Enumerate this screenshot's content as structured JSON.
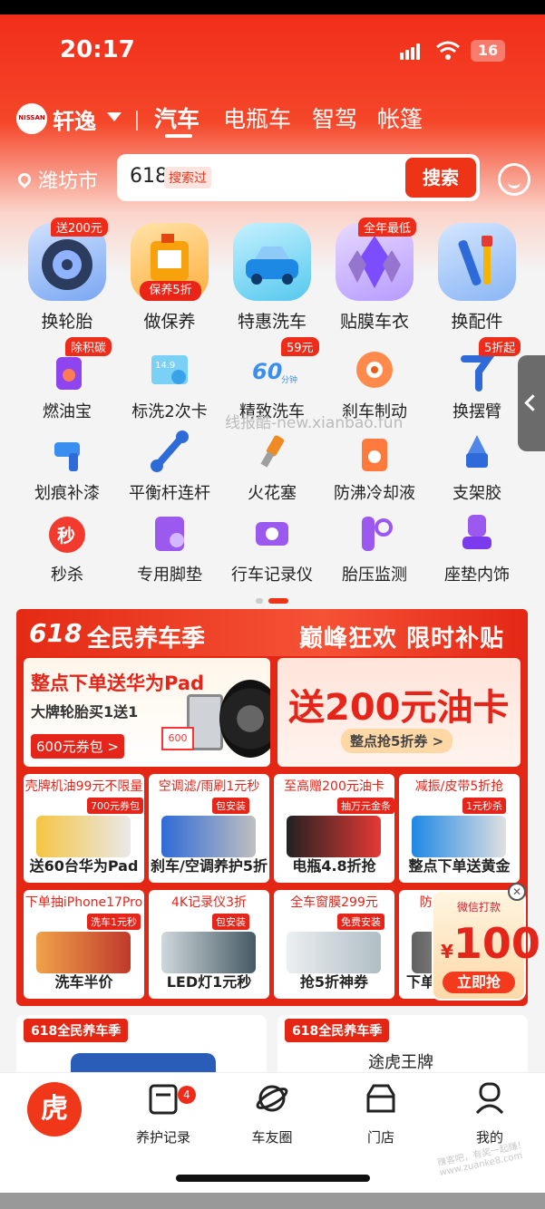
{
  "status": {
    "time": "20:17",
    "battery": "16"
  },
  "header": {
    "brand_name": "轩逸",
    "tabs": [
      "汽车",
      "电瓶车",
      "智驾",
      "帐篷"
    ],
    "location": "潍坊市",
    "search": {
      "query": "618",
      "tag": "搜索过",
      "button": "搜索"
    }
  },
  "services_big": [
    {
      "label": "换轮胎",
      "badge": "送200元"
    },
    {
      "label": "做保养",
      "tag": "保养5折"
    },
    {
      "label": "特惠洗车"
    },
    {
      "label": "贴膜车衣",
      "badge": "全年最低"
    },
    {
      "label": "换配件"
    }
  ],
  "services_small": [
    {
      "label": "燃油宝",
      "badge": "除积碳"
    },
    {
      "label": "标洗2次卡",
      "icon_text": "14.9"
    },
    {
      "label": "精致洗车",
      "badge": "59元",
      "icon_text": "60分钟"
    },
    {
      "label": "刹车制动"
    },
    {
      "label": "换摆臂",
      "badge": "5折起"
    },
    {
      "label": "划痕补漆"
    },
    {
      "label": "平衡杆连杆"
    },
    {
      "label": "火花塞"
    },
    {
      "label": "防沸冷却液"
    },
    {
      "label": "支架胶"
    },
    {
      "label": "秒杀",
      "icon_text": "秒"
    },
    {
      "label": "专用脚垫"
    },
    {
      "label": "行车记录仪"
    },
    {
      "label": "胎压监测"
    },
    {
      "label": "座垫内饰"
    }
  ],
  "watermark": "线报酷-new.xianbao.fun",
  "promo": {
    "logo": "618",
    "title": "全民养车季",
    "slogan": "巅峰狂欢 限时补贴",
    "card1": {
      "title": "整点下单送华为Pad",
      "sub": "大牌轮胎买1送1",
      "coupon": "600元券包 >",
      "coupon_tag": "600"
    },
    "card2": {
      "title": "送200元油卡",
      "sub": "整点抢5折券 >"
    },
    "row1": [
      {
        "header": "壳牌机油99元不限量",
        "tag": "700元券包",
        "bottom": "送60台华为Pad"
      },
      {
        "header": "空调滤/雨刷1元秒",
        "tag": "包安装",
        "bottom": "刹车/空调养护5折"
      },
      {
        "header": "至高赠200元油卡",
        "tag": "抽万元金条",
        "bottom": "电瓶4.8折抢"
      },
      {
        "header": "减振/皮带5折抢",
        "tag": "1元秒杀",
        "bottom": "整点下单送黄金"
      }
    ],
    "row2": [
      {
        "header": "下单抽iPhone17Pro",
        "tag": "洗车1元秒",
        "bottom": "洗车半价"
      },
      {
        "header": "4K记录仪3折",
        "tag": "包安装",
        "bottom": "LED灯1元秒"
      },
      {
        "header": "全车窗膜299元",
        "tag": "免费安装",
        "bottom": "抢5折神券"
      },
      {
        "header": "防晒衣89元抢",
        "tag": "",
        "bottom": "下单"
      }
    ],
    "float_coupon": {
      "top": "微信打款",
      "currency": "¥",
      "amount": "100",
      "button": "立即抢"
    }
  },
  "lower": [
    {
      "tag": "618全民养车季",
      "brand": ""
    },
    {
      "tag": "618全民养车季",
      "brand": "途虎王牌"
    }
  ],
  "tabbar": [
    {
      "label": "",
      "icon": "tiger-home-icon",
      "home_text": "虎"
    },
    {
      "label": "养护记录",
      "badge": "4"
    },
    {
      "label": "车友圈"
    },
    {
      "label": "门店"
    },
    {
      "label": "我的"
    }
  ],
  "corner_watermark": "赚客吧，有奖一起赚！ www.zuanke8.com",
  "colors": {
    "accent": "#ee3416",
    "promo_bg": "#e32714"
  }
}
